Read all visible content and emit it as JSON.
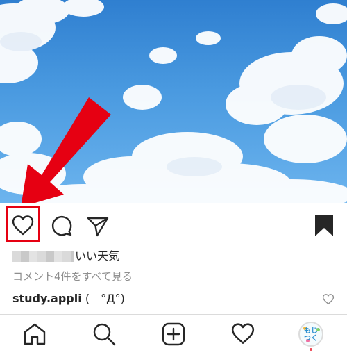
{
  "post": {
    "likes_suffix": "いい天気",
    "comments_link": "コメント4件をすべて見る",
    "caption_user": "study.appli",
    "caption_text": " (　°Д°)"
  },
  "avatar": {
    "line1": "もじ",
    "line2": "つく"
  },
  "colors": {
    "annotation_red": "#e60012",
    "sky_blue": "#3f8fdc",
    "cloud_white": "#ffffff",
    "text_primary": "#262626",
    "text_secondary": "#8e8e8e"
  },
  "icons": {
    "actions": [
      "heart-icon",
      "comment-icon",
      "share-icon",
      "bookmark-icon"
    ],
    "tabbar": [
      "home-icon",
      "search-icon",
      "add-post-icon",
      "activity-heart-icon",
      "profile-avatar"
    ]
  }
}
